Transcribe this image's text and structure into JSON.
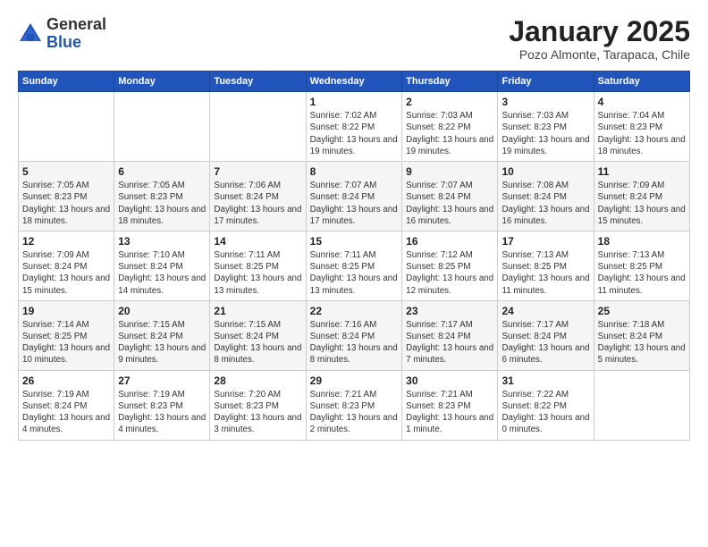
{
  "logo": {
    "general": "General",
    "blue": "Blue"
  },
  "header": {
    "month": "January 2025",
    "location": "Pozo Almonte, Tarapaca, Chile"
  },
  "days_of_week": [
    "Sunday",
    "Monday",
    "Tuesday",
    "Wednesday",
    "Thursday",
    "Friday",
    "Saturday"
  ],
  "weeks": [
    [
      {
        "day": "",
        "info": ""
      },
      {
        "day": "",
        "info": ""
      },
      {
        "day": "",
        "info": ""
      },
      {
        "day": "1",
        "info": "Sunrise: 7:02 AM\nSunset: 8:22 PM\nDaylight: 13 hours and 19 minutes."
      },
      {
        "day": "2",
        "info": "Sunrise: 7:03 AM\nSunset: 8:22 PM\nDaylight: 13 hours and 19 minutes."
      },
      {
        "day": "3",
        "info": "Sunrise: 7:03 AM\nSunset: 8:23 PM\nDaylight: 13 hours and 19 minutes."
      },
      {
        "day": "4",
        "info": "Sunrise: 7:04 AM\nSunset: 8:23 PM\nDaylight: 13 hours and 18 minutes."
      }
    ],
    [
      {
        "day": "5",
        "info": "Sunrise: 7:05 AM\nSunset: 8:23 PM\nDaylight: 13 hours and 18 minutes."
      },
      {
        "day": "6",
        "info": "Sunrise: 7:05 AM\nSunset: 8:23 PM\nDaylight: 13 hours and 18 minutes."
      },
      {
        "day": "7",
        "info": "Sunrise: 7:06 AM\nSunset: 8:24 PM\nDaylight: 13 hours and 17 minutes."
      },
      {
        "day": "8",
        "info": "Sunrise: 7:07 AM\nSunset: 8:24 PM\nDaylight: 13 hours and 17 minutes."
      },
      {
        "day": "9",
        "info": "Sunrise: 7:07 AM\nSunset: 8:24 PM\nDaylight: 13 hours and 16 minutes."
      },
      {
        "day": "10",
        "info": "Sunrise: 7:08 AM\nSunset: 8:24 PM\nDaylight: 13 hours and 16 minutes."
      },
      {
        "day": "11",
        "info": "Sunrise: 7:09 AM\nSunset: 8:24 PM\nDaylight: 13 hours and 15 minutes."
      }
    ],
    [
      {
        "day": "12",
        "info": "Sunrise: 7:09 AM\nSunset: 8:24 PM\nDaylight: 13 hours and 15 minutes."
      },
      {
        "day": "13",
        "info": "Sunrise: 7:10 AM\nSunset: 8:24 PM\nDaylight: 13 hours and 14 minutes."
      },
      {
        "day": "14",
        "info": "Sunrise: 7:11 AM\nSunset: 8:25 PM\nDaylight: 13 hours and 13 minutes."
      },
      {
        "day": "15",
        "info": "Sunrise: 7:11 AM\nSunset: 8:25 PM\nDaylight: 13 hours and 13 minutes."
      },
      {
        "day": "16",
        "info": "Sunrise: 7:12 AM\nSunset: 8:25 PM\nDaylight: 13 hours and 12 minutes."
      },
      {
        "day": "17",
        "info": "Sunrise: 7:13 AM\nSunset: 8:25 PM\nDaylight: 13 hours and 11 minutes."
      },
      {
        "day": "18",
        "info": "Sunrise: 7:13 AM\nSunset: 8:25 PM\nDaylight: 13 hours and 11 minutes."
      }
    ],
    [
      {
        "day": "19",
        "info": "Sunrise: 7:14 AM\nSunset: 8:25 PM\nDaylight: 13 hours and 10 minutes."
      },
      {
        "day": "20",
        "info": "Sunrise: 7:15 AM\nSunset: 8:24 PM\nDaylight: 13 hours and 9 minutes."
      },
      {
        "day": "21",
        "info": "Sunrise: 7:15 AM\nSunset: 8:24 PM\nDaylight: 13 hours and 8 minutes."
      },
      {
        "day": "22",
        "info": "Sunrise: 7:16 AM\nSunset: 8:24 PM\nDaylight: 13 hours and 8 minutes."
      },
      {
        "day": "23",
        "info": "Sunrise: 7:17 AM\nSunset: 8:24 PM\nDaylight: 13 hours and 7 minutes."
      },
      {
        "day": "24",
        "info": "Sunrise: 7:17 AM\nSunset: 8:24 PM\nDaylight: 13 hours and 6 minutes."
      },
      {
        "day": "25",
        "info": "Sunrise: 7:18 AM\nSunset: 8:24 PM\nDaylight: 13 hours and 5 minutes."
      }
    ],
    [
      {
        "day": "26",
        "info": "Sunrise: 7:19 AM\nSunset: 8:24 PM\nDaylight: 13 hours and 4 minutes."
      },
      {
        "day": "27",
        "info": "Sunrise: 7:19 AM\nSunset: 8:23 PM\nDaylight: 13 hours and 4 minutes."
      },
      {
        "day": "28",
        "info": "Sunrise: 7:20 AM\nSunset: 8:23 PM\nDaylight: 13 hours and 3 minutes."
      },
      {
        "day": "29",
        "info": "Sunrise: 7:21 AM\nSunset: 8:23 PM\nDaylight: 13 hours and 2 minutes."
      },
      {
        "day": "30",
        "info": "Sunrise: 7:21 AM\nSunset: 8:23 PM\nDaylight: 13 hours and 1 minute."
      },
      {
        "day": "31",
        "info": "Sunrise: 7:22 AM\nSunset: 8:22 PM\nDaylight: 13 hours and 0 minutes."
      },
      {
        "day": "",
        "info": ""
      }
    ]
  ]
}
